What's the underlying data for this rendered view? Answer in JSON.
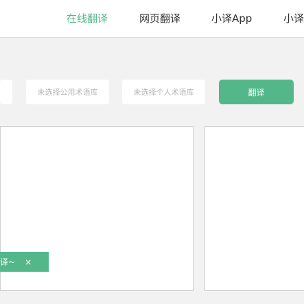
{
  "nav": {
    "items": [
      {
        "label": "在线翻译",
        "active": true
      },
      {
        "label": "网页翻译",
        "active": false
      },
      {
        "label": "小译App",
        "active": false
      },
      {
        "label": "小译",
        "active": false
      }
    ]
  },
  "toolbar": {
    "public_glossary_placeholder": "未选择公用术语库",
    "personal_glossary_placeholder": "未选择个人术语库",
    "translate_label": "翻译"
  },
  "toast": {
    "text": "译~",
    "close_glyph": "×"
  },
  "colors": {
    "accent": "#53b78a",
    "background": "#f2f2f2",
    "nav_text": "#333333",
    "placeholder": "#b5b5b5"
  }
}
